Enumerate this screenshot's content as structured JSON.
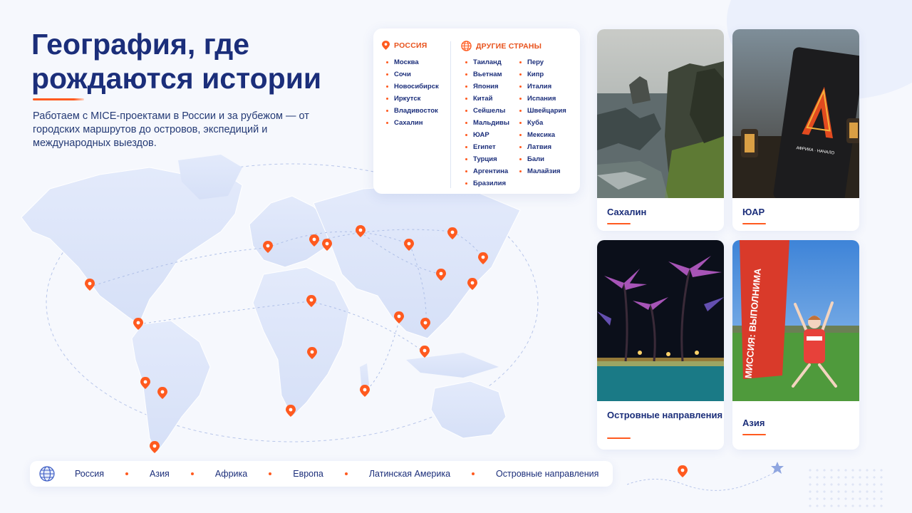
{
  "header": {
    "title": "География, где рождаются истории",
    "subtitle": "Работаем с MICE-проектами в России и за рубежом — от городских маршрутов до островов, экспедиций и международных выездов."
  },
  "locations": {
    "russia": {
      "heading": "РОССИЯ",
      "icon": "pin-icon",
      "cities": [
        "Москва",
        "Сочи",
        "Новосибирск",
        "Иркутск",
        "Владивосток",
        "Сахалин"
      ]
    },
    "other": {
      "heading": "ДРУГИЕ СТРАНЫ",
      "icon": "globe-icon",
      "col1": [
        "Таиланд",
        "Вьетнам",
        "Япония",
        "Китай",
        "Сейшелы",
        "Мальдивы",
        "ЮАР",
        "Египет",
        "Турция",
        "Аргентина",
        "Бразилия"
      ],
      "col2": [
        "Перу",
        "Кипр",
        "Италия",
        "Испания",
        "Швейцария",
        "Куба",
        "Мексика",
        "Латвия",
        "Бали",
        "Малайзия"
      ]
    }
  },
  "cards": [
    {
      "caption": "Сахалин",
      "image": "sakhalin-coast-photo"
    },
    {
      "caption": "ЮАР",
      "image": "africa-menu-photo",
      "image_text": "АФРИКА · НАЧАЛО"
    },
    {
      "caption": "Островные направления",
      "image": "island-palms-night-photo"
    },
    {
      "caption": "Азия",
      "image": "asia-jumping-girl-photo",
      "image_text": "МИССИЯ: ВЫПОЛНИМА"
    }
  ],
  "legend": {
    "icon": "globe-icon",
    "items": [
      "Россия",
      "Азия",
      "Африка",
      "Европа",
      "Латинская Америка",
      "Островные направления"
    ]
  },
  "colors": {
    "accent": "#ff5a1f",
    "navy": "#1b2e7a",
    "background": "#f6f8fd"
  }
}
